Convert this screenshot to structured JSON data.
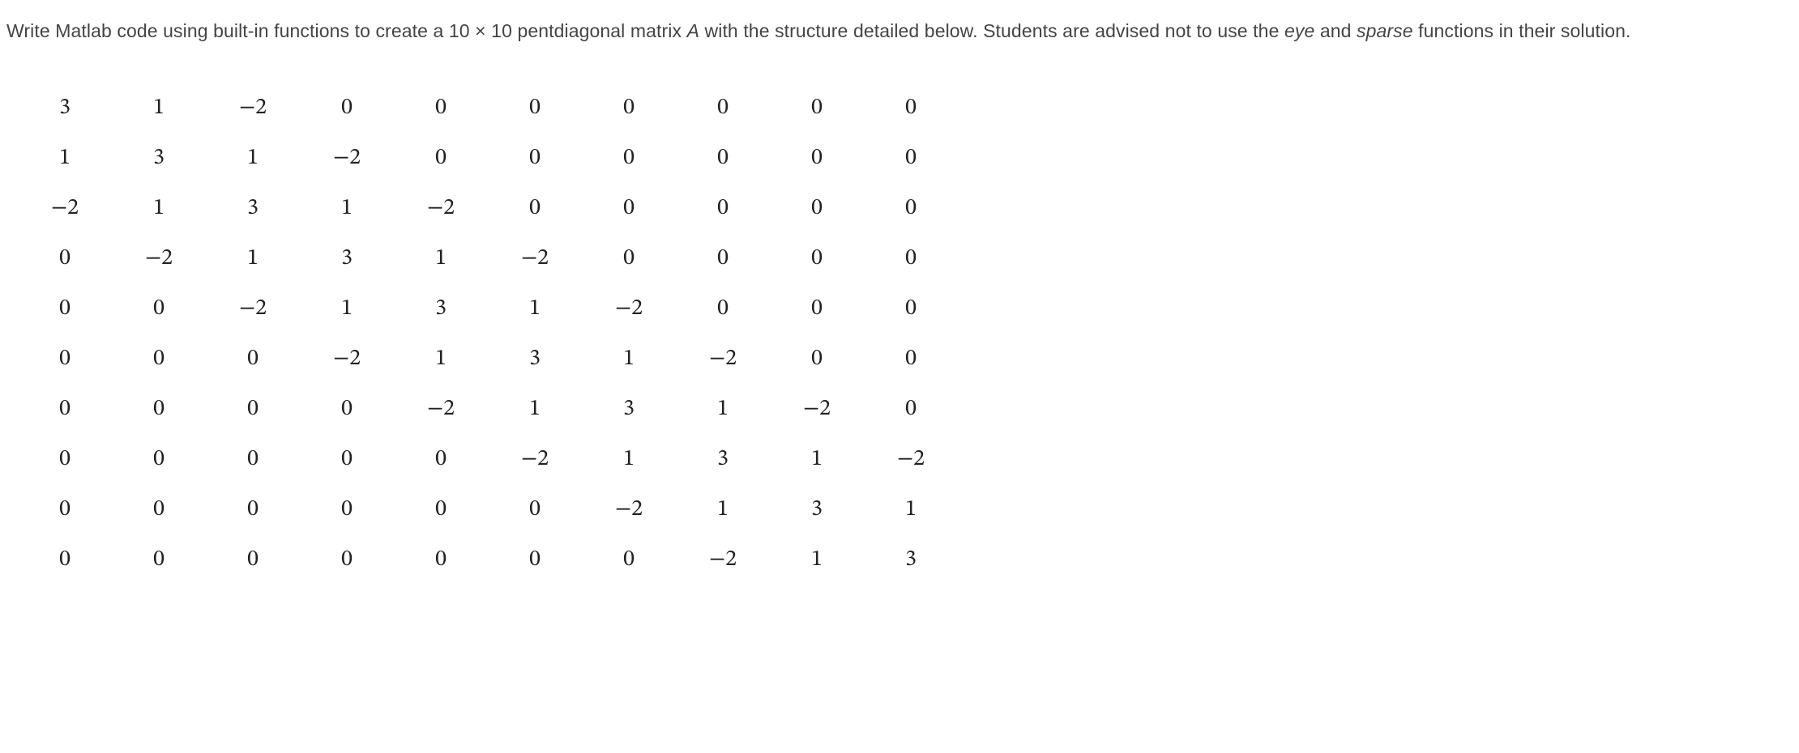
{
  "prompt": {
    "part1": "Write Matlab code using built-in functions to create a 10 ",
    "times": "×",
    "part2": " 10 pentdiagonal matrix ",
    "A": "A",
    "part3": " with the structure detailed below. Students are advised not to use the ",
    "eye": "eye",
    "and": " and ",
    "sparse": "sparse",
    "part4": " functions in their solution."
  },
  "matrix": [
    [
      "3",
      "1",
      "−2",
      "0",
      "0",
      "0",
      "0",
      "0",
      "0",
      "0"
    ],
    [
      "1",
      "3",
      "1",
      "−2",
      "0",
      "0",
      "0",
      "0",
      "0",
      "0"
    ],
    [
      "−2",
      "1",
      "3",
      "1",
      "−2",
      "0",
      "0",
      "0",
      "0",
      "0"
    ],
    [
      "0",
      "−2",
      "1",
      "3",
      "1",
      "−2",
      "0",
      "0",
      "0",
      "0"
    ],
    [
      "0",
      "0",
      "−2",
      "1",
      "3",
      "1",
      "−2",
      "0",
      "0",
      "0"
    ],
    [
      "0",
      "0",
      "0",
      "−2",
      "1",
      "3",
      "1",
      "−2",
      "0",
      "0"
    ],
    [
      "0",
      "0",
      "0",
      "0",
      "−2",
      "1",
      "3",
      "1",
      "−2",
      "0"
    ],
    [
      "0",
      "0",
      "0",
      "0",
      "0",
      "−2",
      "1",
      "3",
      "1",
      "−2"
    ],
    [
      "0",
      "0",
      "0",
      "0",
      "0",
      "0",
      "−2",
      "1",
      "3",
      "1"
    ],
    [
      "0",
      "0",
      "0",
      "0",
      "0",
      "0",
      "0",
      "−2",
      "1",
      "3"
    ]
  ]
}
